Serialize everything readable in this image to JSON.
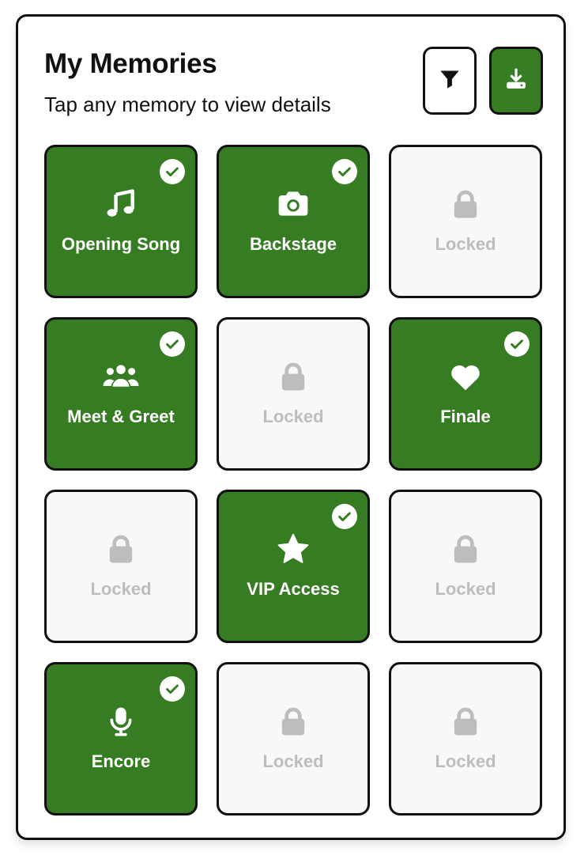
{
  "header": {
    "title": "My Memories",
    "subtitle": "Tap any memory to view details"
  },
  "colors": {
    "accent": "#367c22",
    "locked_bg": "#f8f8f8",
    "locked_text": "#bdbdbd",
    "border": "#111111"
  },
  "toolbar": {
    "filter_icon": "filter-icon",
    "download_icon": "download-icon"
  },
  "memories": [
    {
      "label": "Opening Song",
      "status": "unlocked",
      "icon": "music-icon"
    },
    {
      "label": "Backstage",
      "status": "unlocked",
      "icon": "camera-icon"
    },
    {
      "label": "Locked",
      "status": "locked",
      "icon": "lock-icon"
    },
    {
      "label": "Meet & Greet",
      "status": "unlocked",
      "icon": "users-icon"
    },
    {
      "label": "Locked",
      "status": "locked",
      "icon": "lock-icon"
    },
    {
      "label": "Finale",
      "status": "unlocked",
      "icon": "heart-icon"
    },
    {
      "label": "Locked",
      "status": "locked",
      "icon": "lock-icon"
    },
    {
      "label": "VIP Access",
      "status": "unlocked",
      "icon": "star-icon"
    },
    {
      "label": "Locked",
      "status": "locked",
      "icon": "lock-icon"
    },
    {
      "label": "Encore",
      "status": "unlocked",
      "icon": "microphone-icon"
    },
    {
      "label": "Locked",
      "status": "locked",
      "icon": "lock-icon"
    },
    {
      "label": "Locked",
      "status": "locked",
      "icon": "lock-icon"
    }
  ]
}
